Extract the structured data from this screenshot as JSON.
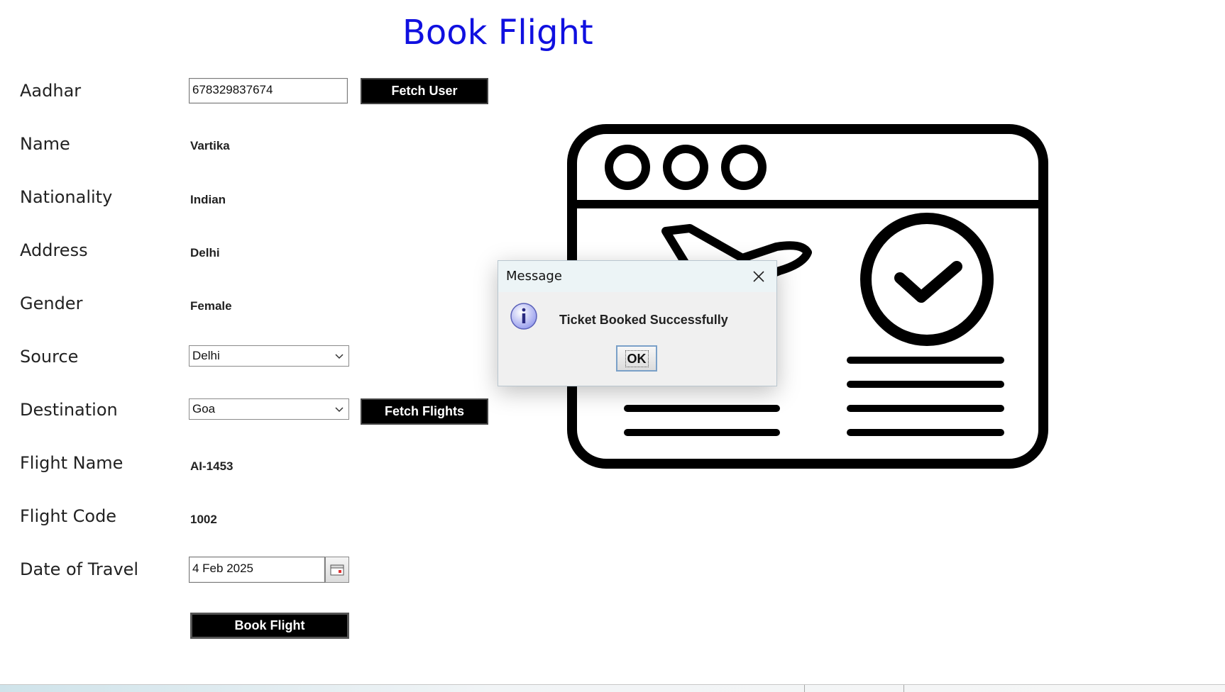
{
  "page": {
    "title": "Book Flight"
  },
  "form": {
    "aadhar_label": "Aadhar",
    "aadhar_value": "678329837674",
    "fetch_user": "Fetch User",
    "name_label": "Name",
    "name_value": "Vartika",
    "nationality_label": "Nationality",
    "nationality_value": "Indian",
    "address_label": "Address",
    "address_value": "Delhi",
    "gender_label": "Gender",
    "gender_value": "Female",
    "source_label": "Source",
    "source_value": "Delhi",
    "destination_label": "Destination",
    "destination_value": "Goa",
    "fetch_flights": "Fetch Flights",
    "flight_name_label": "Flight Name",
    "flight_name_value": "AI-1453",
    "flight_code_label": "Flight Code",
    "flight_code_value": "1002",
    "date_label": "Date of Travel",
    "date_value": "4 Feb 2025",
    "book_flight": "Book Flight"
  },
  "dialog": {
    "title": "Message",
    "message": "Ticket Booked Successfully",
    "ok": "OK",
    "icon": "info-icon"
  },
  "illustration": {
    "icon": "browser-flight-booking-icon"
  },
  "colors": {
    "title": "#1010e0",
    "button_bg": "#000000"
  }
}
